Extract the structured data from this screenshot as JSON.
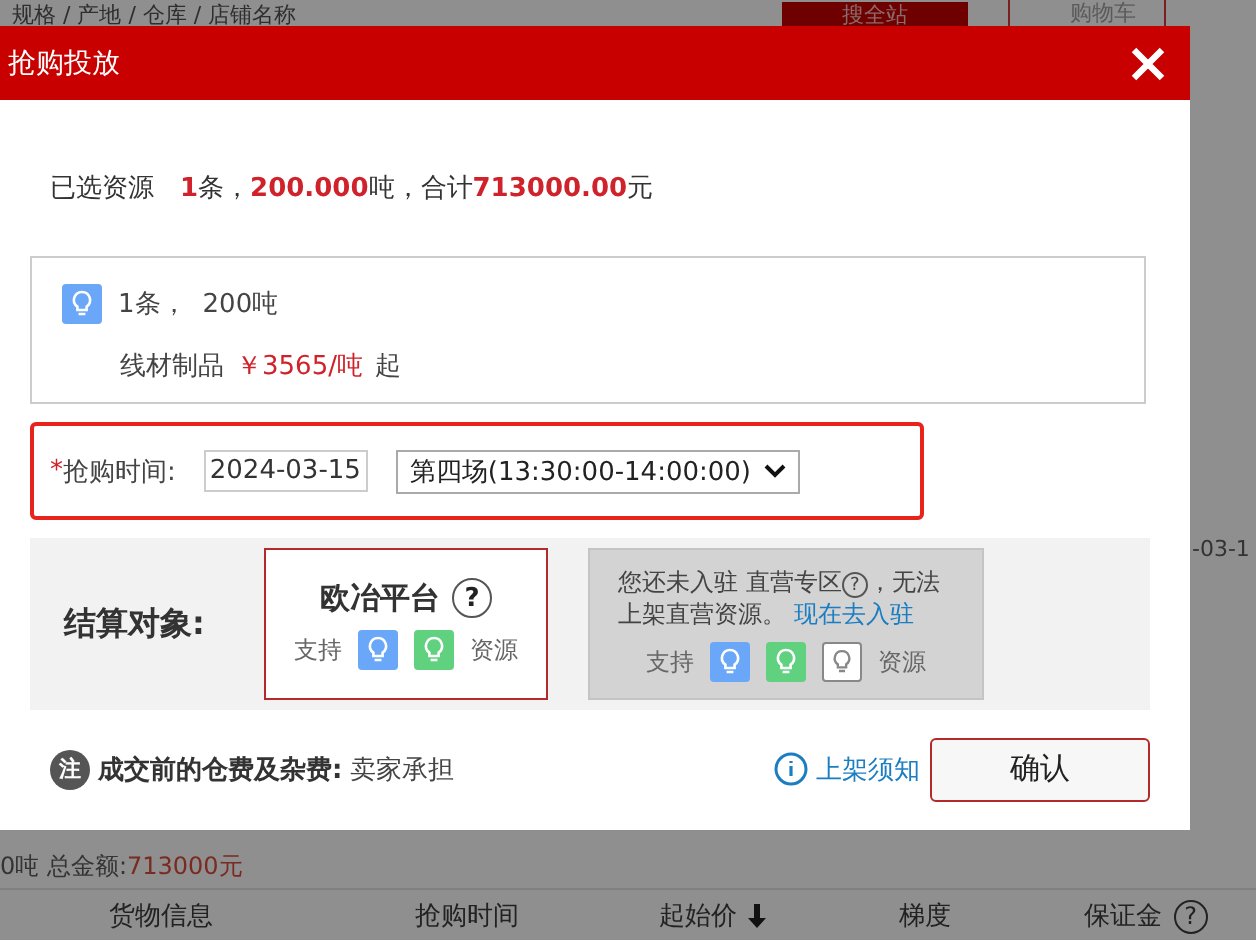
{
  "background": {
    "search_placeholder": "规格 / 产地 / 仓库 / 店铺名称",
    "search_button": "搜全站",
    "cart_button": "购物车",
    "row_date": "-03-1",
    "total_label": "0吨 总金额:",
    "total_value": "713000元",
    "columns": [
      {
        "label": "货物信息",
        "sorted": false
      },
      {
        "label": "抢购时间",
        "sorted": false
      },
      {
        "label": "起始价",
        "sorted": true
      },
      {
        "label": "梯度",
        "sorted": false
      },
      {
        "label": "保证金",
        "sorted": false,
        "help": "?"
      }
    ]
  },
  "dialog": {
    "title": "抢购投放",
    "summary": "已选资源　**1**条，**200.000**吨，合计**713000.00**元",
    "resource": {
      "icons": [
        {
          "color": "#6aa7f8"
        }
      ],
      "count": "1条，",
      "weight": "200吨",
      "product": "线材制品",
      "price": "￥3565/吨",
      "price_suffix": "起"
    },
    "purchase_time": {
      "required_mark": "*",
      "label": "抢购时间:",
      "date": "2024-03-15",
      "session": "第四场(13:30:00-14:00:00)"
    },
    "settlement": {
      "label": "结算对象:",
      "options": [
        {
          "kind": "platform",
          "selected": true,
          "disabled": false,
          "name": "欧冶平台",
          "help": "?",
          "support_label": "支持",
          "resource_icons": [
            {
              "color": "#6aa7f8"
            },
            {
              "color": "#5fd17f"
            }
          ],
          "suffix": "资源"
        },
        {
          "kind": "notice",
          "selected": false,
          "disabled": true,
          "text": "您还未入驻 直营专区",
          "help": "?",
          "text_after": "，无法上架直营资源。",
          "link": "现在去入驻",
          "support_label": "支持",
          "resource_icons": [
            {
              "color": "#6aa7f8"
            },
            {
              "color": "#5fd17f"
            },
            {
              "color": "#ffffff"
            }
          ],
          "suffix": "资源"
        }
      ]
    },
    "note": {
      "badge": "注",
      "label": "成交前的仓费及杂费:",
      "value": "卖家承担"
    },
    "guide_link": "上架须知",
    "confirm_button": "确认"
  }
}
